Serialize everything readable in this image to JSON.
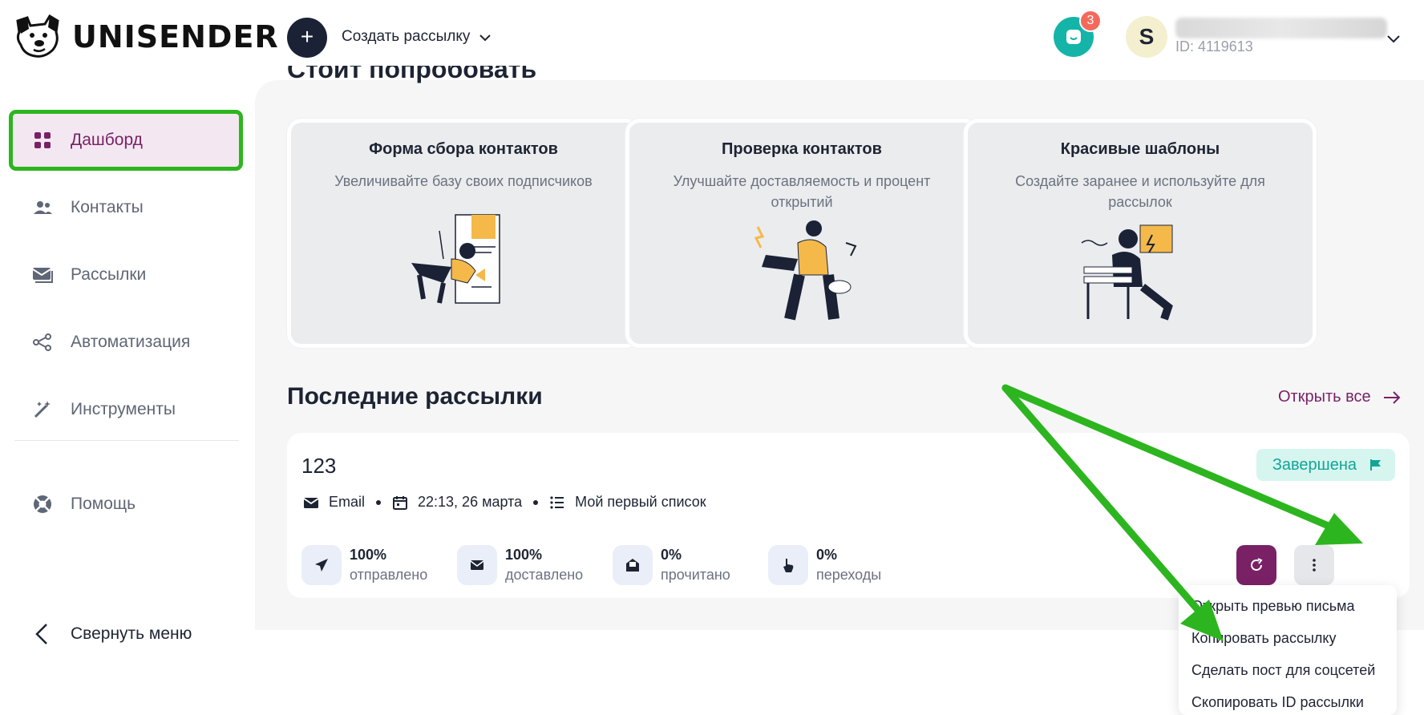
{
  "header": {
    "logo_text": "UNISENDER",
    "create_label": "Создать рассылку",
    "support_badge_count": "3",
    "avatar_letter": "S",
    "user_id": "ID: 4119613"
  },
  "sidebar": {
    "items": [
      {
        "label": "Дашборд",
        "icon": "dashboard-icon",
        "active": true
      },
      {
        "label": "Контакты",
        "icon": "contacts-icon"
      },
      {
        "label": "Рассылки",
        "icon": "mailings-icon"
      },
      {
        "label": "Автоматизация",
        "icon": "automation-icon"
      },
      {
        "label": "Инструменты",
        "icon": "tools-icon"
      },
      {
        "label": "Помощь",
        "icon": "help-icon"
      }
    ],
    "collapse_label": "Свернуть меню"
  },
  "try_section": {
    "title": "Стоит попробовать",
    "cards": [
      {
        "title": "Форма сбора контактов",
        "desc": "Увеличивайте базу своих подписчиков"
      },
      {
        "title": "Проверка контактов",
        "desc": "Улучшайте доставляемость и процент открытий"
      },
      {
        "title": "Красивые шаблоны",
        "desc": "Создайте заранее и используйте для рассылок"
      }
    ]
  },
  "recent": {
    "title": "Последние рассылки",
    "open_all": "Открыть все",
    "mailing": {
      "name": "123",
      "status": "Завершена",
      "channel": "Email",
      "datetime": "22:13, 26 марта",
      "list": "Мой первый список",
      "stats": [
        {
          "value": "100%",
          "caption": "отправлено"
        },
        {
          "value": "100%",
          "caption": "доставлено"
        },
        {
          "value": "0%",
          "caption": "прочитано"
        },
        {
          "value": "0%",
          "caption": "переходы"
        }
      ]
    },
    "menu": [
      "Открыть превью письма",
      "Копировать рассылку",
      "Сделать пост для соцсетей",
      "Скопировать ID рассылки"
    ]
  },
  "colors": {
    "brand": "#7a2166",
    "highlight_outline": "#2db51f",
    "status_green": "#12a596",
    "support": "#14b5a8",
    "header_dark": "#1b2236"
  }
}
